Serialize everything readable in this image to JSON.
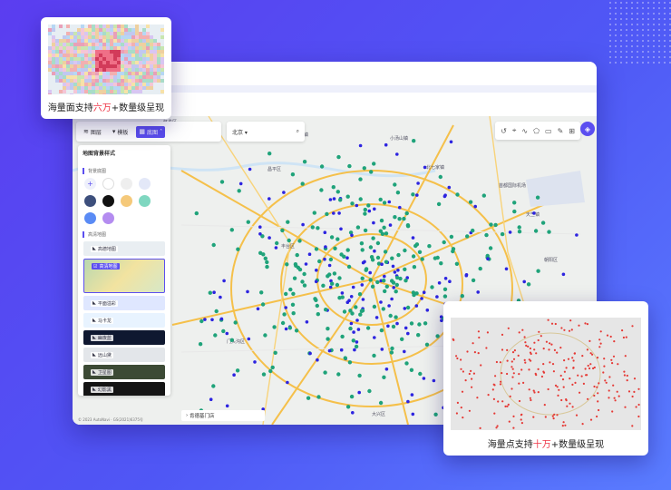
{
  "toolbar": {
    "items": [
      {
        "label": "图层",
        "icon": "layers-icon"
      },
      {
        "label": "模板",
        "icon": "shirt-icon"
      },
      {
        "label": "底图",
        "icon": "basemap-icon",
        "active": true
      }
    ]
  },
  "search": {
    "city": "北京"
  },
  "panel": {
    "title": "地图背景样式",
    "section_bg_color": "背景底图",
    "section_hd_map": "高清地图",
    "swatches": [
      "add",
      "#ffffff",
      "#eeeeee",
      "#e3e8f8",
      "#3d4f7c",
      "#111111",
      "#f5c97a",
      "#7fd7c0",
      "#5a8bf5",
      "#b48cf0"
    ],
    "styles": [
      "高德地图",
      "高清地图",
      "平面溢彩",
      "马卡龙",
      "幽夜蓝",
      "远山黛",
      "卫星图",
      "幻影黑"
    ]
  },
  "map": {
    "labels": [
      "怀柔区",
      "双桥门镇",
      "小汤山镇",
      "昌平区",
      "北七家镇",
      "顺义区",
      "首都国际机场",
      "天竺镇",
      "丰台区",
      "朝阳区",
      "通州区",
      "大兴区",
      "门头沟区",
      "稻景山",
      "青云店镇",
      "马驹桥镇"
    ],
    "store_label": "肯德基门店",
    "copyright": "© 2023 AutoNavi · GS(2021)6375号"
  },
  "cards": {
    "area_caption_pre": "海量面支持",
    "area_caption_hl": "六万",
    "area_caption_post": "+数量级呈现",
    "points_caption_pre": "海量点支持",
    "points_caption_hl": "十万",
    "points_caption_post": "+数量级呈现"
  },
  "colors": {
    "accent": "#5b4ef0",
    "point_green": "#1fa37a",
    "point_blue": "#2d24e0",
    "point_red": "#e53935"
  }
}
